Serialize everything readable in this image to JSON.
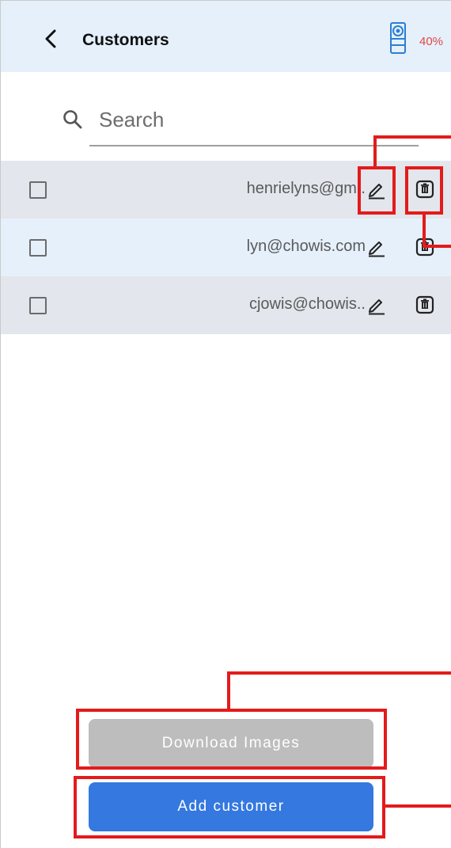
{
  "header": {
    "title": "Customers",
    "battery_percent": "40%"
  },
  "search": {
    "placeholder": "Search"
  },
  "customers": [
    {
      "email": "henrielyns@gm.."
    },
    {
      "email": "lyn@chowis.com"
    },
    {
      "email": "cjowis@chowis.."
    }
  ],
  "buttons": {
    "download_images": "Download Images",
    "add_customer": "Add customer"
  },
  "colors": {
    "header_bg": "#e5f0fb",
    "row_gray": "#e3e6ec",
    "row_blue": "#e5f0fb",
    "battery_text": "#e04848",
    "download_disabled": "#bdbdbd",
    "add_primary": "#3478e0",
    "annotation": "#e31b1b"
  },
  "icons": {
    "back": "chevron-left-icon",
    "battery": "device-battery-icon",
    "search": "search-icon",
    "edit": "pencil-icon",
    "delete": "trash-icon"
  }
}
